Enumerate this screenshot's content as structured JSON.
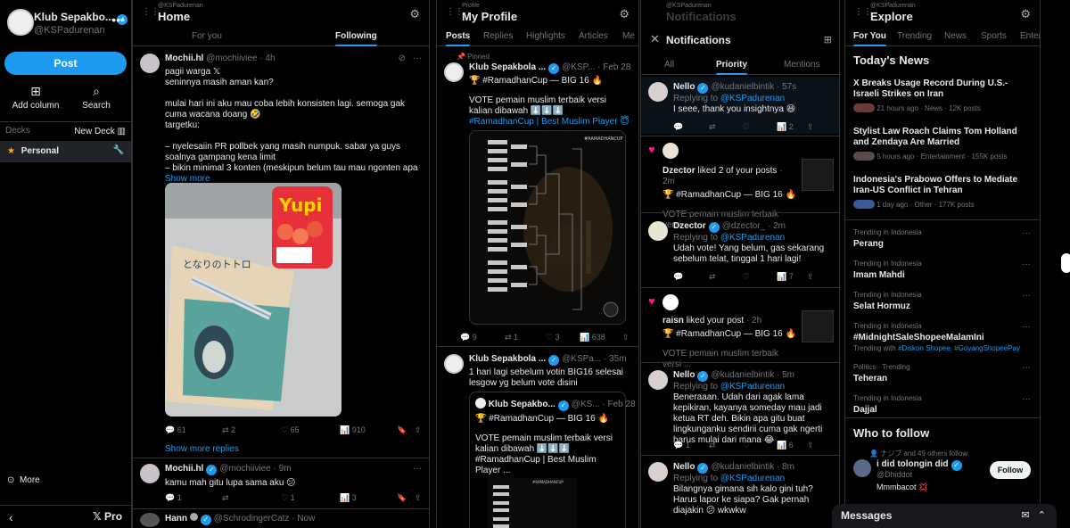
{
  "sidebar": {
    "account_name": "Klub Sepakbo...",
    "account_handle": "@KSPadurenan",
    "post_label": "Post",
    "add_column_label": "Add column",
    "search_label": "Search",
    "decks_label": "Decks",
    "new_deck_label": "New Deck",
    "personal_label": "Personal",
    "more_label": "More",
    "pro_label": "Pro"
  },
  "home": {
    "handle": "@KSPadurenan",
    "title": "Home",
    "tab_foryou": "For you",
    "tab_following": "Following",
    "tweet1": {
      "name": "Mochii.hl",
      "handle": "@mochiiviee",
      "time": "· 4h",
      "line1": "pagii warga 𝕏",
      "line2": "seninnya masih aman kan?",
      "line3": "mulai hari ini aku mau coba lebih konsisten lagi. semoga gak cuma wacana doang 🤣",
      "line4": "targetku:",
      "line5": "– nyelesaiin PR pollbek yang masih numpuk. sabar ya guys soalnya gampang kena limit",
      "line6": "– bikin minimal 3 konten (meskipun belum tau mau ngonten apa",
      "show_more": "Show more",
      "replies": "61",
      "retweets": "2",
      "likes": "65",
      "views": "910",
      "show_more_replies": "Show more replies"
    },
    "tweet2": {
      "name": "Mochii.hl",
      "handle": "@mochiiviee",
      "time": "· 9m",
      "text": "kamu mah gitu lupa sama aku 😕",
      "replies": "1",
      "retweets": "",
      "likes": "1",
      "views": "3"
    },
    "tweet3": {
      "name": "Hann",
      "handle": "@SchrodingerCatz",
      "time": "· Now"
    }
  },
  "profile": {
    "handle_label": "Profile",
    "title": "My Profile",
    "tabs": [
      "Posts",
      "Replies",
      "Highlights",
      "Articles",
      "Me"
    ],
    "pinned": "Pinned",
    "tweet1": {
      "name": "Klub Sepakbola ...",
      "handle": "@KSP...",
      "time": "· Feb 28",
      "line1": "🏆 #RamadhanCup — BIG 16 🔥",
      "line2": "VOTE pemain muslim terbaik versi kalian dibawah ⬇️⬇️⬇️",
      "line3": "#RamadhanCup | Best Muslim Player 😇",
      "replies": "9",
      "retweets": "1",
      "likes": "3",
      "views": "638"
    },
    "tweet2": {
      "name": "Klub Sepakbola ...",
      "handle": "@KSPa...",
      "time": "· 35m",
      "text": "1 hari lagi sebelum votin BIG16 selesai lesgow yg belum vote disini",
      "quote_name": "Klub Sepakbo...",
      "quote_handle": "@KS...",
      "quote_time": "· Feb 28",
      "quote_line1": "🏆 #RamadhanCup — BIG 16 🔥",
      "quote_line2": "VOTE pemain muslim terbaik versi kalian dibawah ⬇️⬇️⬇️",
      "quote_line3": "#RamadhanCup | Best Muslim Player ..."
    }
  },
  "notifications": {
    "handle": "@KSPadurenan",
    "title": "Notifications",
    "tab_all": "All",
    "tab_priority": "Priority",
    "tab_mentions": "Mentions",
    "n1": {
      "name": "Nello",
      "handle": "@kudanielbintik",
      "time": "· 57s",
      "replying": "Replying to",
      "replying_to": "@KSPadurenan",
      "text": "I seee, thank you insightnya 😆",
      "likes": "2"
    },
    "n2": {
      "name": "Dzector",
      "action": "liked 2 of your posts",
      "time": "· 2m",
      "line1": "🏆 #RamadhanCup — BIG 16 🔥",
      "line2": "VOTE pemain muslim terbaik versi ..."
    },
    "n3": {
      "name": "Dzector",
      "handle": "@dzector_",
      "time": "· 2m",
      "replying": "Replying to",
      "replying_to": "@KSPadurenan",
      "text": "Udah vote! Yang belum, gas sekarang sebelum telat, tinggal 1 hari lagi!",
      "likes": "7"
    },
    "n4": {
      "name": "raisn",
      "action": "liked your post",
      "time": "· 2h",
      "line1": "🏆 #RamadhanCup — BIG 16 🔥",
      "line2": "VOTE pemain muslim terbaik versi ..."
    },
    "n5": {
      "name": "Nello",
      "handle": "@kudanielbintik",
      "time": "· 5m",
      "replying": "Replying to",
      "replying_to": "@KSPadurenan",
      "text": "Beneraaan. Udah dari agak lama kepikiran, kayanya someday mau jadi ketua RT deh. Bikin apa gitu buat lingkunganku sendirii cuma gak ngerti harus mulai dari mana 😂",
      "replies": "1",
      "likes": "6"
    },
    "n6": {
      "name": "Nello",
      "handle": "@kudanielbintik",
      "time": "· 8m",
      "replying": "Replying to",
      "replying_to": "@KSPadurenan",
      "text": "Bilangnya gimana sih kalo gini tuh? Harus lapor ke siapa? Gak pernah diajakin 😕 wkwkw"
    }
  },
  "explore": {
    "handle": "@KSPadurenan",
    "title": "Explore",
    "tabs": [
      "For You",
      "Trending",
      "News",
      "Sports",
      "Enter"
    ],
    "todays_news": "Today's News",
    "news": [
      {
        "title": "X Breaks Usage Record During U.S.-Israeli Strikes on Iran",
        "meta": "21 hours ago · News · 12K posts"
      },
      {
        "title": "Stylist Law Roach Claims Tom Holland and Zendaya Are Married",
        "meta": "5 hours ago · Entertainment · 155K posts"
      },
      {
        "title": "Indonesia's Prabowo Offers to Mediate Iran-US Conflict in Tehran",
        "meta": "1 day ago · Other · 177K posts"
      }
    ],
    "trends": [
      {
        "context": "Trending in Indonesia",
        "name": "Perang",
        "extra": ""
      },
      {
        "context": "Trending in Indonesia",
        "name": "Imam Mahdi",
        "extra": ""
      },
      {
        "context": "Trending in Indonesia",
        "name": "Selat Hormuz",
        "extra": ""
      },
      {
        "context": "Trending in Indonesia",
        "name": "#MidnightSaleShopeeMalamIni",
        "extra": "Trending with"
      },
      {
        "context": "Politics · Trending",
        "name": "Teheran",
        "extra": ""
      },
      {
        "context": "Trending in Indonesia",
        "name": "Dajjal",
        "extra": ""
      }
    ],
    "trend4_tags": "#Diskon Shopee, #GoyangShopeePay",
    "who_to_follow": "Who to follow",
    "follow_context": "ナジブ and 49 others follow",
    "follow_name": "i did tolongin did",
    "follow_handle": "@Dhiddot",
    "follow_bio": "Mmmbacot 💢",
    "follow_button": "Follow"
  },
  "messages": {
    "title": "Messages"
  }
}
